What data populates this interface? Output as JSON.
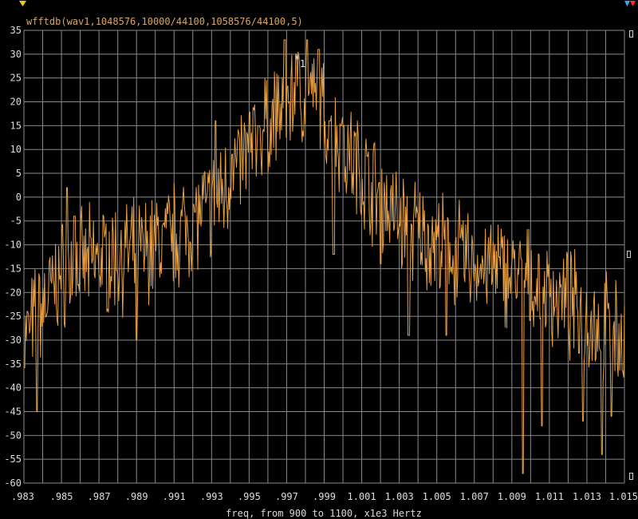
{
  "colors": {
    "background": "#000000",
    "grid": "#8a8a8a",
    "trace": "#e8a040",
    "title": "#d8a860",
    "text": "#dddddd",
    "cursor_yellow": "#f0d000",
    "cursor_blue": "#40a0ff",
    "cursor_red": "#ff3030"
  },
  "icons": {
    "top_left": "yellow-triangle-cursor-icon",
    "top_right": "blue-red-triangle-cursor-icon"
  },
  "chart_data": {
    "type": "line",
    "title": "wfftdb(wav1,1048576,10000/44100,1058576/44100,5)",
    "xlabel": "freq, from 900 to 1100, x1e3 Hertz",
    "ylabel": "",
    "xlim": [
      0.983,
      1.015
    ],
    "ylim": [
      -60,
      35
    ],
    "xticks": [
      0.983,
      0.985,
      0.987,
      0.989,
      0.991,
      0.993,
      0.995,
      0.997,
      0.999,
      1.001,
      1.003,
      1.005,
      1.007,
      1.009,
      1.011,
      1.013,
      1.015
    ],
    "xtick_labels": [
      ".983",
      ".985",
      ".987",
      ".989",
      ".991",
      ".993",
      ".995",
      ".997",
      ".999",
      "1.001",
      "1.003",
      "1.005",
      "1.007",
      "1.009",
      "1.011",
      "1.013",
      "1.015"
    ],
    "yticks": [
      35,
      30,
      25,
      20,
      15,
      10,
      5,
      0,
      -5,
      -10,
      -15,
      -20,
      -25,
      -30,
      -35,
      -40,
      -45,
      -50,
      -55,
      -60
    ],
    "grid": true,
    "marker": {
      "label": "1",
      "x": 0.9977,
      "y": 28
    },
    "envelope": [
      [
        0.983,
        -30
      ],
      [
        0.985,
        -16
      ],
      [
        0.987,
        -13
      ],
      [
        0.989,
        -12
      ],
      [
        0.991,
        -8
      ],
      [
        0.993,
        -2
      ],
      [
        0.995,
        10
      ],
      [
        0.997,
        20
      ],
      [
        0.998,
        22
      ],
      [
        0.999,
        17
      ],
      [
        1.001,
        5
      ],
      [
        1.003,
        -5
      ],
      [
        1.005,
        -10
      ],
      [
        1.007,
        -14
      ],
      [
        1.009,
        -16
      ],
      [
        1.011,
        -20
      ],
      [
        1.013,
        -25
      ],
      [
        1.015,
        -30
      ]
    ],
    "dips": [
      [
        0.9837,
        -45
      ],
      [
        0.989,
        -30
      ],
      [
        0.9995,
        -12
      ],
      [
        1.002,
        -14
      ],
      [
        1.0035,
        -29
      ],
      [
        1.0055,
        -29
      ],
      [
        1.0096,
        -58
      ],
      [
        1.0106,
        -48
      ],
      [
        1.0128,
        -47
      ],
      [
        1.0138,
        -54
      ],
      [
        1.0143,
        -46
      ]
    ],
    "peaks": [
      [
        0.9969,
        33
      ],
      [
        0.9981,
        33
      ],
      [
        0.9987,
        31
      ],
      [
        0.9975,
        30
      ],
      [
        0.9993,
        16
      ],
      [
        0.9999,
        15
      ],
      [
        0.9932,
        16
      ],
      [
        0.9955,
        15
      ],
      [
        0.9941,
        9
      ],
      [
        0.9853,
        2
      ],
      [
        0.9857,
        -4
      ]
    ],
    "n_samples": 760,
    "seed": 7
  }
}
